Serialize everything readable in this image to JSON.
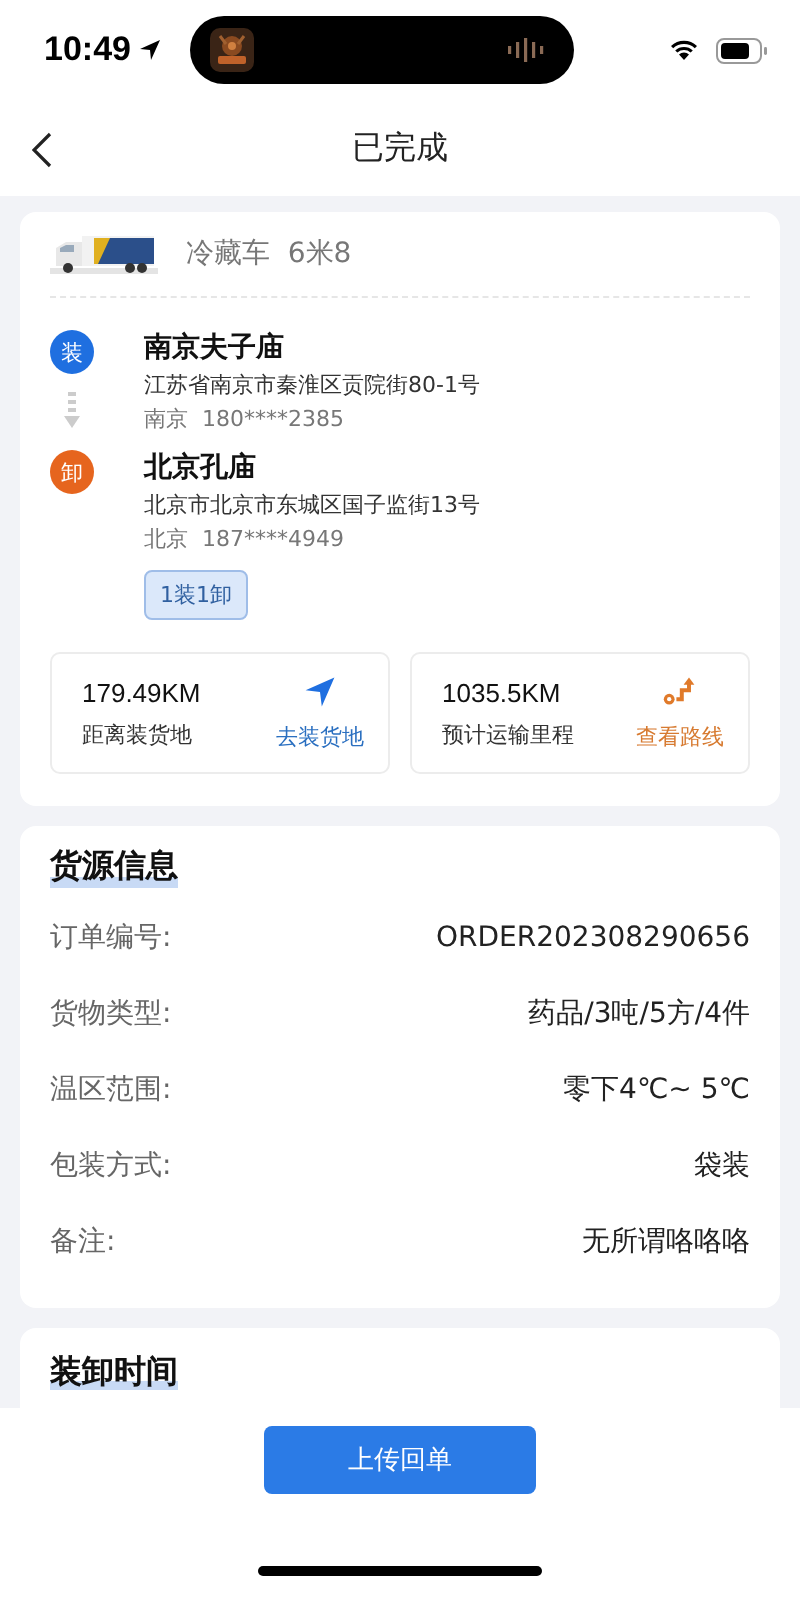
{
  "status_bar": {
    "time": "10:49"
  },
  "nav": {
    "title": "已完成"
  },
  "vehicle": {
    "kind": "picture",
    "type": "冷藏车",
    "length": "6米8"
  },
  "stops": [
    {
      "kind": "load",
      "badge": "装",
      "name": "南京夫子庙",
      "address": "江苏省南京市秦淮区贡院街80-1号",
      "city": "南京",
      "phone": "180****2385"
    },
    {
      "kind": "unload",
      "badge": "卸",
      "name": "北京孔庙",
      "address": "北京市北京市东城区国子监街13号",
      "city": "北京",
      "phone": "187****4949"
    }
  ],
  "stop_tag": "1装1卸",
  "stats": [
    {
      "kind": "navigate",
      "value": "179.49KM",
      "label": "距离装货地",
      "action": "去装货地"
    },
    {
      "kind": "route",
      "value": "1035.5KM",
      "label": "预计运输里程",
      "action": "查看路线"
    }
  ],
  "cargo": {
    "title": "货源信息",
    "rows": [
      {
        "label": "订单编号:",
        "value": "ORDER202308290656"
      },
      {
        "label": "货物类型:",
        "value": "药品/3吨/5方/4件"
      },
      {
        "label": "温区范围:",
        "value": "零下4℃~ 5℃"
      },
      {
        "label": "包装方式:",
        "value": "袋装"
      },
      {
        "label": "备注:",
        "value": "无所谓咯咯咯"
      }
    ]
  },
  "schedule": {
    "title": "装卸时间"
  },
  "upload_button": "上传回单"
}
